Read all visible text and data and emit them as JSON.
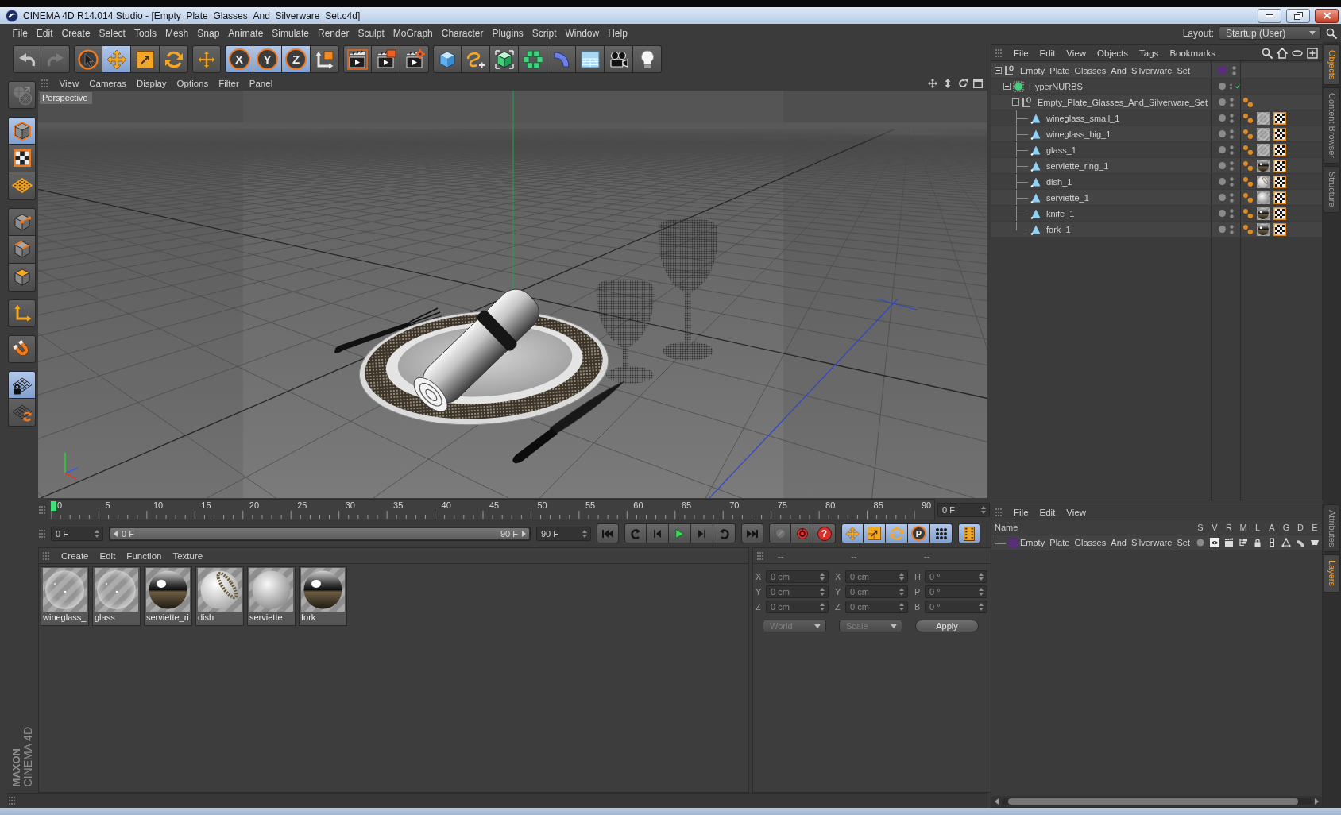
{
  "window": {
    "title": "CINEMA 4D R14.014 Studio - [Empty_Plate_Glasses_And_Silverware_Set.c4d]"
  },
  "menu_bar": [
    "File",
    "Edit",
    "Create",
    "Select",
    "Tools",
    "Mesh",
    "Snap",
    "Animate",
    "Simulate",
    "Render",
    "Sculpt",
    "MoGraph",
    "Character",
    "Plugins",
    "Script",
    "Window",
    "Help"
  ],
  "layout": {
    "label": "Layout:",
    "value": "Startup (User)"
  },
  "toolbar": [
    [
      {
        "kind": "undo",
        "disabled": false
      },
      {
        "kind": "redo",
        "disabled": true
      }
    ],
    [
      {
        "kind": "select",
        "selected": false
      },
      {
        "kind": "move",
        "selected": true
      },
      {
        "kind": "scale",
        "selected": false
      },
      {
        "kind": "rotate",
        "selected": false
      }
    ],
    [
      {
        "kind": "recent",
        "selected": false
      }
    ],
    [
      {
        "kind": "axis-lock",
        "label": "X",
        "selected": true
      },
      {
        "kind": "axis-lock",
        "label": "Y",
        "selected": true
      },
      {
        "kind": "axis-lock",
        "label": "Z",
        "selected": true
      },
      {
        "kind": "coordinates",
        "selected": false
      }
    ],
    [
      {
        "kind": "render-view"
      },
      {
        "kind": "render-picture"
      },
      {
        "kind": "render-settings"
      }
    ],
    [
      {
        "kind": "cube"
      },
      {
        "kind": "pen"
      },
      {
        "kind": "subdivision"
      },
      {
        "kind": "cloner"
      },
      {
        "kind": "deformer"
      },
      {
        "kind": "floor"
      },
      {
        "kind": "camera"
      },
      {
        "kind": "light"
      }
    ]
  ],
  "mode_tools": [
    [
      {
        "kind": "make-editable",
        "selected": false
      }
    ],
    [
      {
        "kind": "model",
        "selected": true
      },
      {
        "kind": "texture",
        "selected": false
      },
      {
        "kind": "workplane",
        "selected": false
      }
    ],
    [
      {
        "kind": "points",
        "selected": false
      },
      {
        "kind": "edges",
        "selected": false
      },
      {
        "kind": "polygons",
        "selected": false
      }
    ],
    [
      {
        "kind": "axis",
        "selected": false
      }
    ],
    [
      {
        "kind": "snap",
        "selected": false
      }
    ],
    [
      {
        "kind": "workplane-lock",
        "selected": true
      },
      {
        "kind": "planar",
        "selected": false
      }
    ]
  ],
  "brand": {
    "company": "MAXON",
    "product": "CINEMA 4D"
  },
  "viewport": {
    "menu": [
      "View",
      "Cameras",
      "Display",
      "Options",
      "Filter",
      "Panel"
    ],
    "camera_label": "Perspective"
  },
  "timeline": {
    "frame_labels": [
      "0",
      "5",
      "10",
      "15",
      "20",
      "25",
      "30",
      "35",
      "40",
      "45",
      "50",
      "55",
      "60",
      "65",
      "70",
      "75",
      "80",
      "85",
      "90"
    ],
    "playhead": {
      "level": 0
    },
    "current_frame": "0 F"
  },
  "transport": {
    "start_field": "0 F",
    "range": {
      "start": "0 F",
      "end": "90 F",
      "level": 1
    },
    "end_field": "90 F",
    "playback": [
      [
        {
          "kind": "first"
        }
      ],
      [
        {
          "kind": "prev-key"
        },
        {
          "kind": "prev-frame"
        },
        {
          "kind": "play"
        },
        {
          "kind": "next-frame"
        },
        {
          "kind": "next-key"
        }
      ],
      [
        {
          "kind": "last"
        }
      ]
    ],
    "record": [
      {
        "kind": "autokey",
        "disabled": true
      },
      {
        "kind": "record",
        "disabled": false
      },
      {
        "kind": "help",
        "label": "?",
        "disabled": false
      }
    ],
    "keys": [
      {
        "kind": "position",
        "selected": true
      },
      {
        "kind": "scale",
        "selected": true
      },
      {
        "kind": "rotation",
        "selected": true
      },
      {
        "kind": "parameter",
        "label": "P",
        "selected": true
      },
      {
        "kind": "point-level",
        "selected": true
      }
    ],
    "timeline_button": {
      "selected": true
    }
  },
  "materials": {
    "menu": [
      "Create",
      "Edit",
      "Function",
      "Texture"
    ],
    "items": [
      {
        "name": "wineglass_",
        "kind": "glass"
      },
      {
        "name": "glass",
        "kind": "glass"
      },
      {
        "name": "serviette_ri",
        "kind": "chrome"
      },
      {
        "name": "dish",
        "kind": "ornament"
      },
      {
        "name": "serviette",
        "kind": "matte"
      },
      {
        "name": "fork",
        "kind": "chrome"
      }
    ]
  },
  "coordinates": {
    "headers": [
      "--",
      "--",
      "--"
    ],
    "rows": [
      [
        {
          "label": "X",
          "value": "0 cm"
        },
        {
          "label": "X",
          "value": "0 cm"
        },
        {
          "label": "H",
          "value": "0 °"
        }
      ],
      [
        {
          "label": "Y",
          "value": "0 cm"
        },
        {
          "label": "Y",
          "value": "0 cm"
        },
        {
          "label": "P",
          "value": "0 °"
        }
      ],
      [
        {
          "label": "Z",
          "value": "0 cm"
        },
        {
          "label": "Z",
          "value": "0 cm"
        },
        {
          "label": "B",
          "value": "0 °"
        }
      ]
    ],
    "dropdowns": [
      {
        "value": "World",
        "disabled": true
      },
      {
        "value": "Scale",
        "disabled": true
      }
    ],
    "apply": "Apply"
  },
  "objects": {
    "menu": [
      "File",
      "Edit",
      "View",
      "Objects",
      "Tags",
      "Bookmarks"
    ],
    "tree": [
      {
        "name": "Empty_Plate_Glasses_And_Silverware_Set",
        "kind": "null",
        "color": "#5b2d7d",
        "expanded": true,
        "children": [
          {
            "name": "HyperNURBS",
            "kind": "subdivision",
            "enabled": true,
            "expanded": true,
            "children": [
              {
                "name": "Empty_Plate_Glasses_And_Silverware_Set",
                "kind": "null",
                "expanded": true,
                "tags": [
                  {
                    "kind": "phong"
                  }
                ],
                "children": [
                  {
                    "name": "wineglass_small_1",
                    "kind": "polygon",
                    "tags": [
                      {
                        "kind": "phong"
                      },
                      {
                        "kind": "material-glass"
                      },
                      {
                        "kind": "uvw"
                      }
                    ]
                  },
                  {
                    "name": "wineglass_big_1",
                    "kind": "polygon",
                    "tags": [
                      {
                        "kind": "phong"
                      },
                      {
                        "kind": "material-glass"
                      },
                      {
                        "kind": "uvw"
                      }
                    ]
                  },
                  {
                    "name": "glass_1",
                    "kind": "polygon",
                    "tags": [
                      {
                        "kind": "phong"
                      },
                      {
                        "kind": "material-glass"
                      },
                      {
                        "kind": "uvw"
                      }
                    ]
                  },
                  {
                    "name": "serviette_ring_1",
                    "kind": "polygon",
                    "tags": [
                      {
                        "kind": "phong"
                      },
                      {
                        "kind": "material-chrome"
                      },
                      {
                        "kind": "uvw"
                      }
                    ]
                  },
                  {
                    "name": "dish_1",
                    "kind": "polygon",
                    "tags": [
                      {
                        "kind": "phong"
                      },
                      {
                        "kind": "material-ornament"
                      },
                      {
                        "kind": "uvw"
                      }
                    ]
                  },
                  {
                    "name": "serviette_1",
                    "kind": "polygon",
                    "tags": [
                      {
                        "kind": "phong"
                      },
                      {
                        "kind": "material-matte"
                      },
                      {
                        "kind": "uvw"
                      }
                    ]
                  },
                  {
                    "name": "knife_1",
                    "kind": "polygon",
                    "tags": [
                      {
                        "kind": "phong"
                      },
                      {
                        "kind": "material-chrome"
                      },
                      {
                        "kind": "uvw"
                      }
                    ]
                  },
                  {
                    "name": "fork_1",
                    "kind": "polygon",
                    "tags": [
                      {
                        "kind": "phong"
                      },
                      {
                        "kind": "material-chrome"
                      },
                      {
                        "kind": "uvw"
                      }
                    ]
                  }
                ]
              }
            ]
          }
        ]
      }
    ]
  },
  "layers": {
    "menu": [
      "File",
      "Edit",
      "View"
    ],
    "columns": [
      "Name",
      "S",
      "V",
      "R",
      "M",
      "L",
      "A",
      "G",
      "D",
      "E"
    ],
    "rows": [
      {
        "name": "Empty_Plate_Glasses_And_Silverware_Set",
        "color": "#5b2d7d"
      }
    ]
  },
  "side_tabs": {
    "upper": [
      {
        "label": "Objects",
        "selected": true
      },
      {
        "label": "Content Browser",
        "selected": false
      },
      {
        "label": "Structure",
        "selected": false
      }
    ],
    "lower": [
      {
        "label": "Attributes",
        "selected": false
      },
      {
        "label": "Layers",
        "selected": true
      }
    ]
  }
}
